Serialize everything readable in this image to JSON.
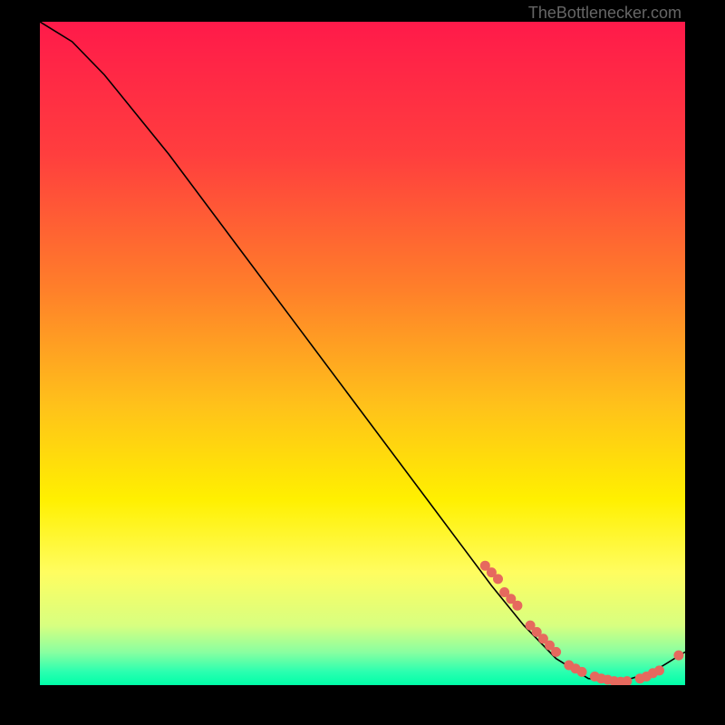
{
  "attribution": "TheBottlenecker.com",
  "chart_data": {
    "type": "line",
    "title": "",
    "xlabel": "",
    "ylabel": "",
    "x_range": [
      0,
      100
    ],
    "y_range": [
      0,
      100
    ],
    "curve": [
      {
        "x": 0,
        "y": 100
      },
      {
        "x": 5,
        "y": 97
      },
      {
        "x": 10,
        "y": 92
      },
      {
        "x": 20,
        "y": 80
      },
      {
        "x": 30,
        "y": 67
      },
      {
        "x": 40,
        "y": 54
      },
      {
        "x": 50,
        "y": 41
      },
      {
        "x": 60,
        "y": 28
      },
      {
        "x": 70,
        "y": 15
      },
      {
        "x": 75,
        "y": 9
      },
      {
        "x": 80,
        "y": 4
      },
      {
        "x": 85,
        "y": 1
      },
      {
        "x": 90,
        "y": 0.5
      },
      {
        "x": 95,
        "y": 2
      },
      {
        "x": 100,
        "y": 5
      }
    ],
    "overlay_dots": [
      {
        "x": 69,
        "y": 18
      },
      {
        "x": 70,
        "y": 17
      },
      {
        "x": 71,
        "y": 16
      },
      {
        "x": 72,
        "y": 14
      },
      {
        "x": 73,
        "y": 13
      },
      {
        "x": 74,
        "y": 12
      },
      {
        "x": 76,
        "y": 9
      },
      {
        "x": 77,
        "y": 8
      },
      {
        "x": 78,
        "y": 7
      },
      {
        "x": 79,
        "y": 6
      },
      {
        "x": 80,
        "y": 5
      },
      {
        "x": 82,
        "y": 3
      },
      {
        "x": 83,
        "y": 2.5
      },
      {
        "x": 84,
        "y": 2
      },
      {
        "x": 86,
        "y": 1.3
      },
      {
        "x": 87,
        "y": 1
      },
      {
        "x": 88,
        "y": 0.8
      },
      {
        "x": 89,
        "y": 0.6
      },
      {
        "x": 90,
        "y": 0.5
      },
      {
        "x": 91,
        "y": 0.6
      },
      {
        "x": 93,
        "y": 1
      },
      {
        "x": 94,
        "y": 1.3
      },
      {
        "x": 95,
        "y": 1.8
      },
      {
        "x": 96,
        "y": 2.2
      },
      {
        "x": 99,
        "y": 4.5
      }
    ],
    "gradient_stops": [
      {
        "offset": 0,
        "color": "#ff1a4a"
      },
      {
        "offset": 20,
        "color": "#ff3e3e"
      },
      {
        "offset": 40,
        "color": "#ff7e2a"
      },
      {
        "offset": 58,
        "color": "#ffc21a"
      },
      {
        "offset": 72,
        "color": "#fff000"
      },
      {
        "offset": 83,
        "color": "#fffd60"
      },
      {
        "offset": 91,
        "color": "#d8ff80"
      },
      {
        "offset": 95,
        "color": "#8affa0"
      },
      {
        "offset": 98,
        "color": "#2affb0"
      },
      {
        "offset": 100,
        "color": "#00ffa8"
      }
    ],
    "dot_color": "#e6695e",
    "curve_color": "#000000"
  }
}
